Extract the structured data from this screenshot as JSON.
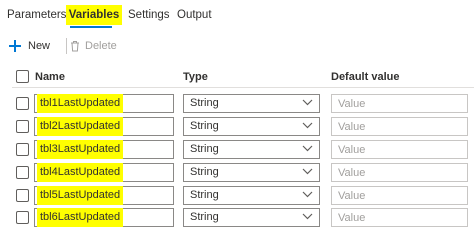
{
  "tabs": [
    {
      "label": "Parameters"
    },
    {
      "label": "Variables"
    },
    {
      "label": "Settings"
    },
    {
      "label": "Output"
    }
  ],
  "active_tab": "Variables",
  "toolbar": {
    "new_label": "New",
    "delete_label": "Delete"
  },
  "table": {
    "headers": {
      "name": "Name",
      "type": "Type",
      "default": "Default value"
    },
    "rows": [
      {
        "name": "tbl1LastUpdated",
        "type": "String",
        "default_placeholder": "Value"
      },
      {
        "name": "tbl2LastUpdated",
        "type": "String",
        "default_placeholder": "Value"
      },
      {
        "name": "tbl3LastUpdated",
        "type": "String",
        "default_placeholder": "Value"
      },
      {
        "name": "tbl4LastUpdated",
        "type": "String",
        "default_placeholder": "Value"
      },
      {
        "name": "tbl5LastUpdated",
        "type": "String",
        "default_placeholder": "Value"
      },
      {
        "name": "tbl6LastUpdated",
        "type": "String",
        "default_placeholder": "Value"
      }
    ]
  },
  "colors": {
    "accent": "#0078d4",
    "highlight": "#ffff00"
  }
}
